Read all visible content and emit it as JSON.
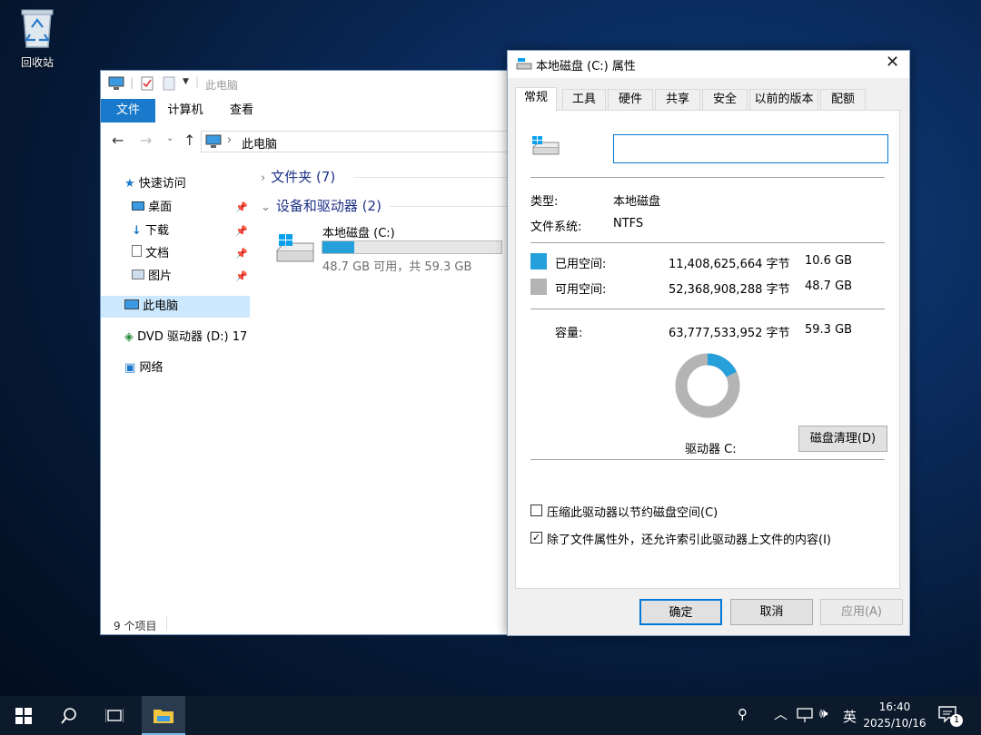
{
  "desktop": {
    "recycle_bin_label": "回收站"
  },
  "explorer": {
    "title": "此电脑",
    "ribbon_tabs": [
      "文件",
      "计算机",
      "查看"
    ],
    "address_path": "此电脑",
    "nav": {
      "quick_access": "快速访问",
      "desktop": "桌面",
      "downloads": "下载",
      "documents": "文档",
      "pictures": "图片",
      "this_pc": "此电脑",
      "dvd": "DVD 驱动器 (D:) 17",
      "network": "网络"
    },
    "groups": {
      "folders": "文件夹 (7)",
      "devices": "设备和驱动器 (2)"
    },
    "drive": {
      "name": "本地磁盘 (C:)",
      "free_text": "48.7 GB 可用，共 59.3 GB",
      "used_fraction": 0.18
    },
    "status": "9 个项目"
  },
  "dialog": {
    "title": "本地磁盘 (C:) 属性",
    "tabs": [
      "常规",
      "工具",
      "硬件",
      "共享",
      "安全",
      "以前的版本",
      "配额"
    ],
    "label_input_value": "",
    "type_label": "类型:",
    "type_value": "本地磁盘",
    "fs_label": "文件系统:",
    "fs_value": "NTFS",
    "used_label": "已用空间:",
    "used_bytes": "11,408,625,664 字节",
    "used_gb": "10.6 GB",
    "free_label": "可用空间:",
    "free_bytes": "52,368,908,288 字节",
    "free_gb": "48.7 GB",
    "capacity_label": "容量:",
    "capacity_bytes": "63,777,533,952 字节",
    "capacity_gb": "59.3 GB",
    "used_fraction": 0.179,
    "drive_label": "驱动器 C:",
    "cleanup_button": "磁盘清理(D)",
    "compress_label": "压缩此驱动器以节约磁盘空间(C)",
    "compress_checked": false,
    "index_label": "除了文件属性外，还允许索引此驱动器上文件的内容(I)",
    "index_checked": true,
    "ok_button": "确定",
    "cancel_button": "取消",
    "apply_button": "应用(A)"
  },
  "taskbar": {
    "time": "16:40",
    "date": "2025/10/16",
    "ime": "英",
    "notification_count": "1"
  },
  "colors": {
    "used": "#26a0da",
    "free": "#b4b4b4",
    "accent": "#0078d7"
  }
}
